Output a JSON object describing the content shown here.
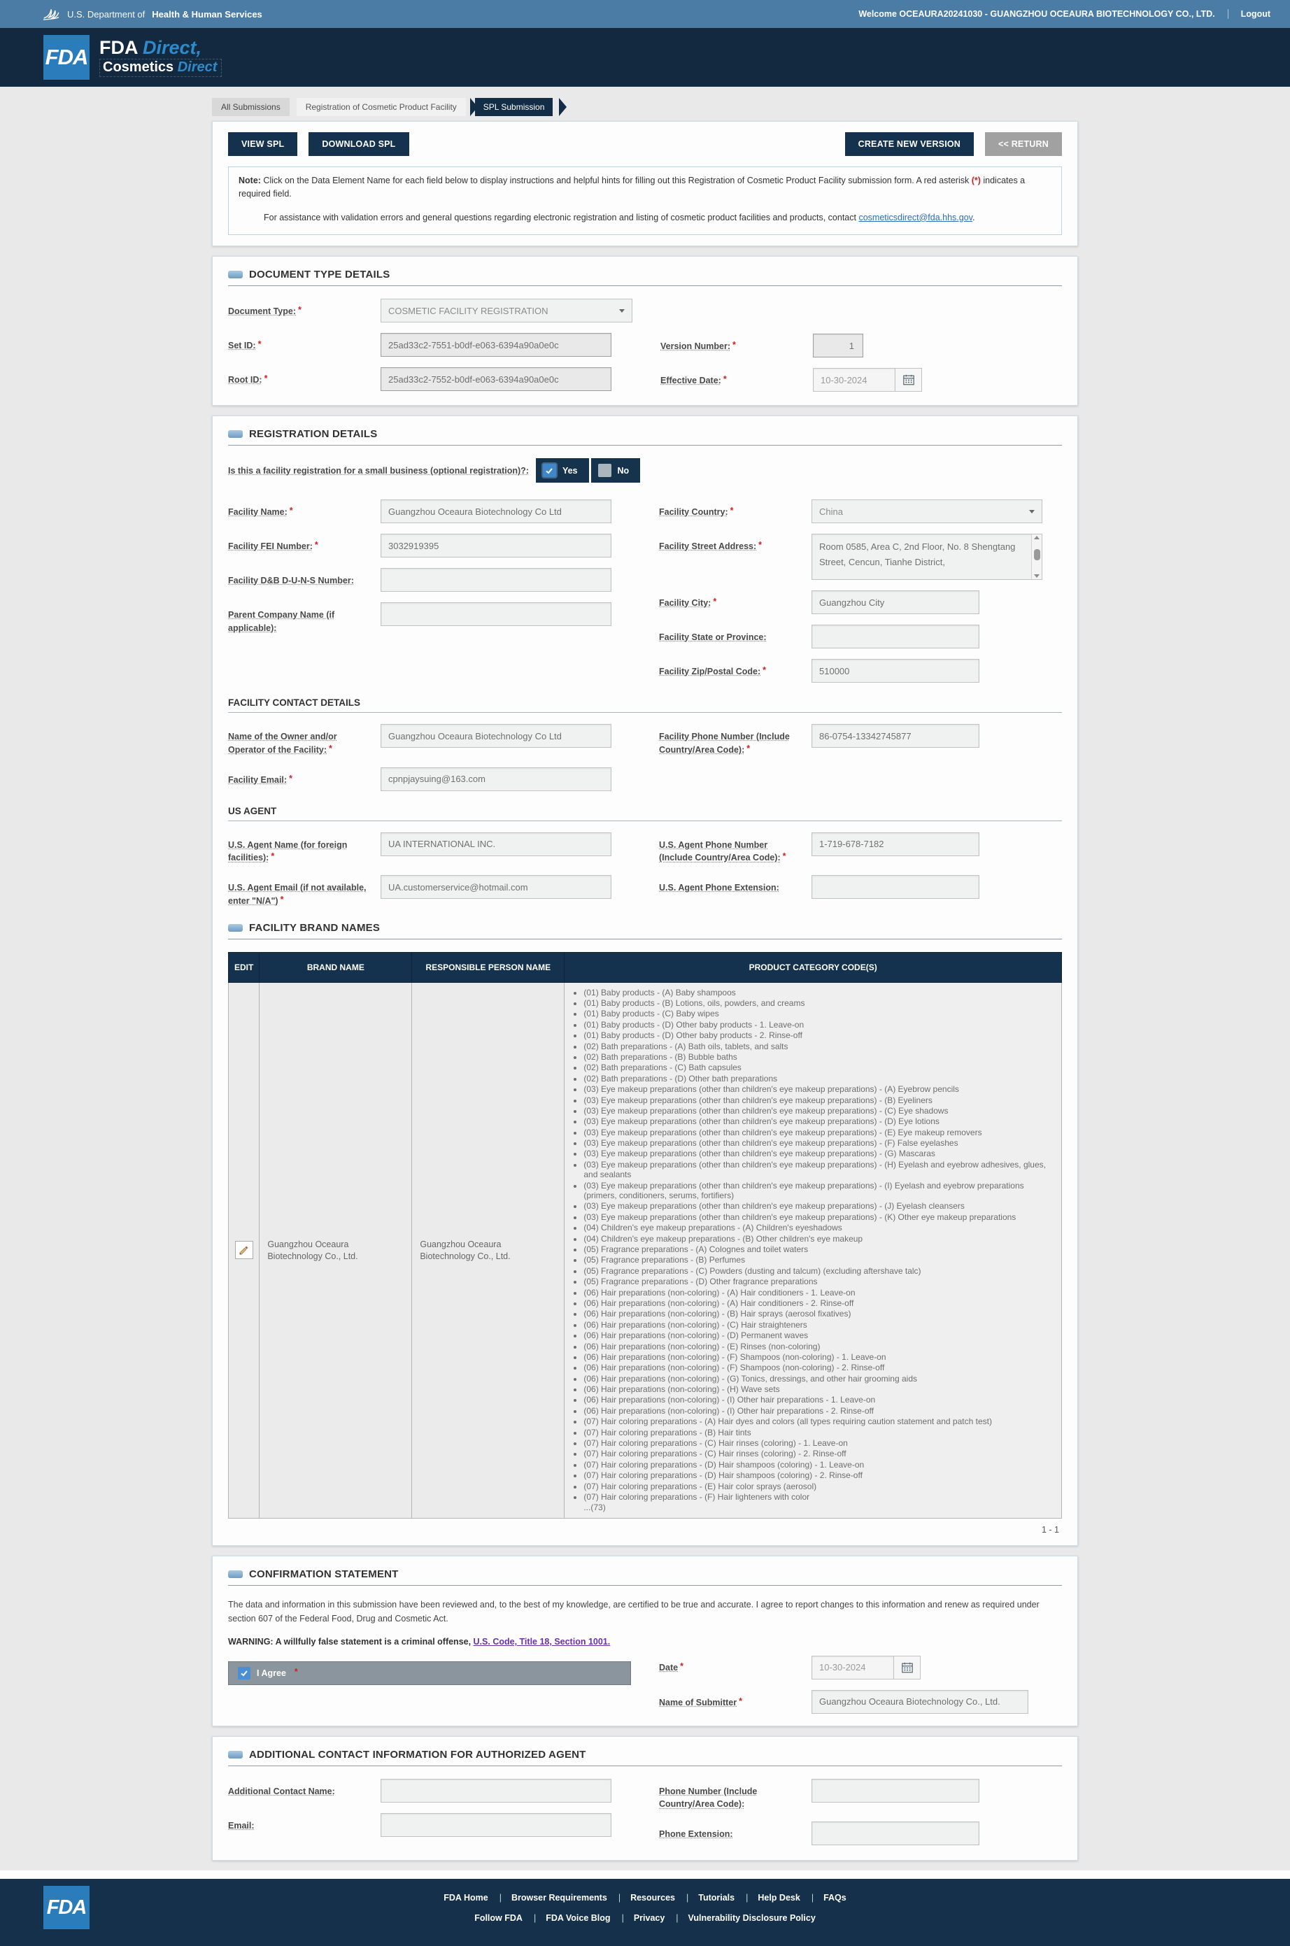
{
  "topbar": {
    "dept_prefix": "U.S. Department of",
    "dept_bold": "Health & Human Services",
    "welcome": "Welcome OCEAURA20241030 - GUANGZHOU OCEAURA BIOTECHNOLOGY CO., LTD.",
    "logout": "Logout"
  },
  "header": {
    "logo": "FDA",
    "brand": "FDA",
    "brand_accent": "Direct,",
    "product": "Cosmetics",
    "product_accent": "Direct"
  },
  "breadcrumb": {
    "item1": "All Submissions",
    "item2": "Registration of Cosmetic Product Facility",
    "item3": "SPL Submission"
  },
  "toolbar": {
    "view": "VIEW SPL",
    "download": "DOWNLOAD SPL",
    "create": "CREATE NEW VERSION",
    "return": "<< RETURN"
  },
  "note": {
    "prefix": "Note:",
    "body": " Click on the Data Element Name for each field below to display instructions and helpful hints for filling out this Registration of Cosmetic Product Facility submission form. A red asterisk ",
    "asterisk": "(*)",
    "suffix": " indicates a required field.",
    "assist": "For assistance with validation errors and general questions regarding electronic registration and listing of cosmetic product facilities and products, contact ",
    "assist_link": "cosmeticsdirect@fda.hhs.gov",
    "assist_end": "."
  },
  "doc_type": {
    "title": "DOCUMENT TYPE DETAILS",
    "document_type": {
      "label": "Document Type:",
      "value": "COSMETIC FACILITY REGISTRATION"
    },
    "set_id": {
      "label": "Set ID:",
      "value": "25ad33c2-7551-b0df-e063-6394a90a0e0c"
    },
    "version": {
      "label": "Version Number:",
      "value": "1"
    },
    "root_id": {
      "label": "Root ID:",
      "value": "25ad33c2-7552-b0df-e063-6394a90a0e0c"
    },
    "effective_date": {
      "label": "Effective Date:",
      "value": "10-30-2024"
    }
  },
  "registration": {
    "title": "REGISTRATION DETAILS",
    "small_biz_label": "Is this a facility registration for a small business (optional registration)?:",
    "yes": "Yes",
    "no": "No",
    "facility_name": {
      "label": "Facility Name:",
      "value": "Guangzhou Oceaura Biotechnology Co Ltd"
    },
    "facility_country": {
      "label": "Facility Country:",
      "value": "China"
    },
    "fei_number": {
      "label": "Facility FEI Number:",
      "value": "3032919395"
    },
    "street": {
      "label": "Facility Street Address:",
      "value": "Room 0585, Area C, 2nd Floor, No. 8 Shengtang Street, Cencun, Tianhe District,"
    },
    "duns": {
      "label": "Facility D&B D-U-N-S Number:",
      "value": ""
    },
    "city": {
      "label": "Facility City:",
      "value": "Guangzhou City"
    },
    "parent": {
      "label": "Parent Company Name (if applicable):",
      "value": ""
    },
    "state": {
      "label": "Facility State or Province:",
      "value": ""
    },
    "zip": {
      "label": "Facility Zip/Postal Code:",
      "value": "510000"
    }
  },
  "facility_contact": {
    "title": "FACILITY CONTACT DETAILS",
    "owner": {
      "label": "Name of the Owner and/or Operator of the Facility:",
      "value": "Guangzhou Oceaura Biotechnology Co Ltd"
    },
    "phone": {
      "label": "Facility Phone Number (Include Country/Area Code):",
      "value": "86-0754-13342745877"
    },
    "email": {
      "label": "Facility Email:",
      "value": "cpnpjaysuing@163.com"
    }
  },
  "us_agent": {
    "title": "US AGENT",
    "name": {
      "label": "U.S. Agent Name (for foreign facilities):",
      "value": "UA INTERNATIONAL INC."
    },
    "phone": {
      "label": "U.S. Agent Phone Number (Include Country/Area Code):",
      "value": "1-719-678-7182"
    },
    "email": {
      "label": "U.S. Agent Email (if not available, enter \"N/A\")",
      "value": "UA.customerservice@hotmail.com"
    },
    "ext": {
      "label": "U.S. Agent Phone Extension:",
      "value": ""
    }
  },
  "brand_names": {
    "title": "FACILITY BRAND NAMES",
    "columns": [
      "EDIT",
      "BRAND NAME",
      "RESPONSIBLE PERSON NAME",
      "PRODUCT CATEGORY CODE(S)"
    ],
    "brand": "Guangzhou Oceaura Biotechnology Co., Ltd.",
    "person": "Guangzhou Oceaura Biotechnology Co., Ltd.",
    "categories": [
      "(01) Baby products - (A) Baby shampoos",
      "(01) Baby products - (B) Lotions, oils, powders, and creams",
      "(01) Baby products - (C) Baby wipes",
      "(01) Baby products - (D) Other baby products - 1. Leave-on",
      "(01) Baby products - (D) Other baby products - 2. Rinse-off",
      "(02) Bath preparations - (A) Bath oils, tablets, and salts",
      "(02) Bath preparations - (B) Bubble baths",
      "(02) Bath preparations - (C) Bath capsules",
      "(02) Bath preparations - (D) Other bath preparations",
      "(03) Eye makeup preparations (other than children's eye makeup preparations) - (A) Eyebrow pencils",
      "(03) Eye makeup preparations (other than children's eye makeup preparations) - (B) Eyeliners",
      "(03) Eye makeup preparations (other than children's eye makeup preparations) - (C) Eye shadows",
      "(03) Eye makeup preparations (other than children's eye makeup preparations) - (D) Eye lotions",
      "(03) Eye makeup preparations (other than children's eye makeup preparations) - (E) Eye makeup removers",
      "(03) Eye makeup preparations (other than children's eye makeup preparations) - (F) False eyelashes",
      "(03) Eye makeup preparations (other than children's eye makeup preparations) - (G) Mascaras",
      "(03) Eye makeup preparations (other than children's eye makeup preparations) - (H) Eyelash and eyebrow adhesives, glues, and sealants",
      "(03) Eye makeup preparations (other than children's eye makeup preparations) - (I) Eyelash and eyebrow preparations (primers, conditioners, serums, fortifiers)",
      "(03) Eye makeup preparations (other than children's eye makeup preparations) - (J) Eyelash cleansers",
      "(03) Eye makeup preparations (other than children's eye makeup preparations) - (K) Other eye makeup preparations",
      "(04) Children's eye makeup preparations - (A) Children's eyeshadows",
      "(04) Children's eye makeup preparations - (B) Other children's eye makeup",
      "(05) Fragrance preparations - (A) Colognes and toilet waters",
      "(05) Fragrance preparations - (B) Perfumes",
      "(05) Fragrance preparations - (C) Powders (dusting and talcum) (excluding aftershave talc)",
      "(05) Fragrance preparations - (D) Other fragrance preparations",
      "(06) Hair preparations (non-coloring) - (A) Hair conditioners - 1. Leave-on",
      "(06) Hair preparations (non-coloring) - (A) Hair conditioners - 2. Rinse-off",
      "(06) Hair preparations (non-coloring) - (B) Hair sprays (aerosol fixatives)",
      "(06) Hair preparations (non-coloring) - (C) Hair straighteners",
      "(06) Hair preparations (non-coloring) - (D) Permanent waves",
      "(06) Hair preparations (non-coloring) - (E) Rinses (non-coloring)",
      "(06) Hair preparations (non-coloring) - (F) Shampoos (non-coloring) - 1. Leave-on",
      "(06) Hair preparations (non-coloring) - (F) Shampoos (non-coloring) - 2. Rinse-off",
      "(06) Hair preparations (non-coloring) - (G) Tonics, dressings, and other hair grooming aids",
      "(06) Hair preparations (non-coloring) - (H) Wave sets",
      "(06) Hair preparations (non-coloring) - (I) Other hair preparations - 1. Leave-on",
      "(06) Hair preparations (non-coloring) - (I) Other hair preparations - 2. Rinse-off",
      "(07) Hair coloring preparations - (A) Hair dyes and colors (all types requiring caution statement and patch test)",
      "(07) Hair coloring preparations - (B) Hair tints",
      "(07) Hair coloring preparations - (C) Hair rinses (coloring) - 1. Leave-on",
      "(07) Hair coloring preparations - (C) Hair rinses (coloring) - 2. Rinse-off",
      "(07) Hair coloring preparations - (D) Hair shampoos (coloring) - 1. Leave-on",
      "(07) Hair coloring preparations - (D) Hair shampoos (coloring) - 2. Rinse-off",
      "(07) Hair coloring preparations - (E) Hair color sprays (aerosol)",
      "(07) Hair coloring preparations - (F) Hair lighteners with color"
    ],
    "more": "...(73)",
    "pagination": "1 - 1"
  },
  "confirmation": {
    "title": "CONFIRMATION STATEMENT",
    "statement": "The data and information in this submission have been reviewed and, to the best of my knowledge, are certified to be true and accurate. I agree to report changes to this information and renew as required under section 607 of the Federal Food, Drug and Cosmetic Act.",
    "warning_prefix": "WARNING: A willfully false statement is a criminal offense, ",
    "warning_link": "U.S. Code, Title 18, Section 1001.",
    "agree": "I Agree",
    "date": {
      "label": "Date",
      "value": "10-30-2024"
    },
    "submitter": {
      "label": "Name of Submitter",
      "value": "Guangzhou Oceaura Biotechnology Co., Ltd."
    }
  },
  "additional": {
    "title": "ADDITIONAL CONTACT INFORMATION FOR AUTHORIZED AGENT",
    "name": {
      "label": "Additional Contact Name:",
      "value": ""
    },
    "phone": {
      "label": "Phone Number (Include Country/Area Code):",
      "value": ""
    },
    "email": {
      "label": "Email:",
      "value": ""
    },
    "ext": {
      "label": "Phone Extension:",
      "value": ""
    }
  },
  "footer": {
    "logo": "FDA",
    "row1": [
      "FDA Home",
      "Browser Requirements",
      "Resources",
      "Tutorials",
      "Help Desk",
      "FAQs"
    ],
    "row2": [
      "Follow FDA",
      "FDA Voice Blog",
      "Privacy",
      "Vulnerability Disclosure Policy"
    ]
  },
  "colors": {
    "navy": "#14324e",
    "steel_blue": "#4b7ca6",
    "fda_blue": "#2a7cbb",
    "accent": "#2f8ac9",
    "required_red": "#cc2222",
    "link_blue": "#2a6fb7",
    "link_purple": "#6b2fa8"
  }
}
